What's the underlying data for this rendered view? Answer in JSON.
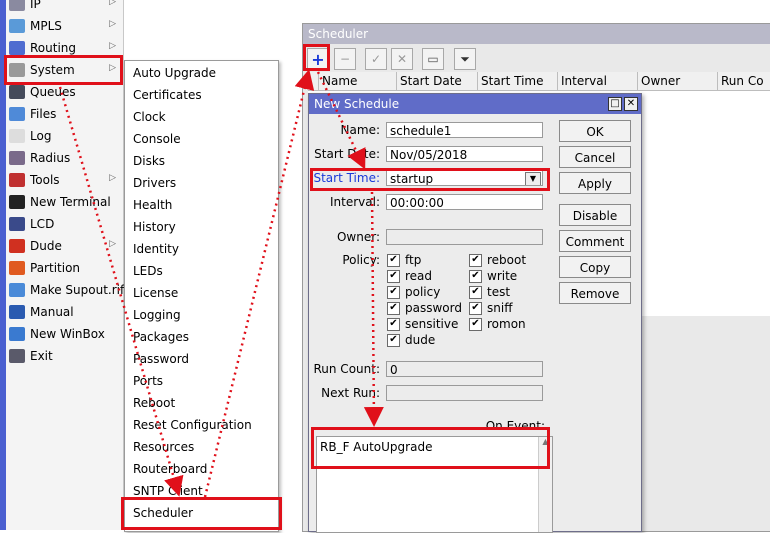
{
  "nav": {
    "items": [
      {
        "label": "IP",
        "icon": "ip-icon",
        "color": "#8a8aa0",
        "arrow": true
      },
      {
        "label": "MPLS",
        "icon": "mpls-icon",
        "color": "#5a9ad8",
        "arrow": true
      },
      {
        "label": "Routing",
        "icon": "routing-icon",
        "color": "#4f6cd0",
        "arrow": true
      },
      {
        "label": "System",
        "icon": "gear-icon",
        "color": "#9a9a9a",
        "arrow": true
      },
      {
        "label": "Queues",
        "icon": "queues-icon",
        "color": "#444a5a",
        "arrow": false
      },
      {
        "label": "Files",
        "icon": "folder-icon",
        "color": "#4f8ad8",
        "arrow": false
      },
      {
        "label": "Log",
        "icon": "log-icon",
        "color": "#dddddd",
        "arrow": false
      },
      {
        "label": "Radius",
        "icon": "radius-icon",
        "color": "#7a6a8a",
        "arrow": false
      },
      {
        "label": "Tools",
        "icon": "tools-icon",
        "color": "#c03030",
        "arrow": true
      },
      {
        "label": "New Terminal",
        "icon": "terminal-icon",
        "color": "#222222",
        "arrow": false
      },
      {
        "label": "LCD",
        "icon": "lcd-icon",
        "color": "#3a4a8a",
        "arrow": false
      },
      {
        "label": "Dude",
        "icon": "dude-icon",
        "color": "#d03020",
        "arrow": true
      },
      {
        "label": "Partition",
        "icon": "partition-icon",
        "color": "#e05a20",
        "arrow": false
      },
      {
        "label": "Make Supout.rif",
        "icon": "supout-icon",
        "color": "#4a8ad8",
        "arrow": false
      },
      {
        "label": "Manual",
        "icon": "manual-icon",
        "color": "#2a5ab0",
        "arrow": false
      },
      {
        "label": "New WinBox",
        "icon": "winbox-icon",
        "color": "#3a7ad0",
        "arrow": false
      },
      {
        "label": "Exit",
        "icon": "exit-icon",
        "color": "#5a5a6a",
        "arrow": false
      }
    ]
  },
  "submenu": {
    "items": [
      "Auto Upgrade",
      "Certificates",
      "Clock",
      "Console",
      "Disks",
      "Drivers",
      "Health",
      "History",
      "Identity",
      "LEDs",
      "License",
      "Logging",
      "Packages",
      "Password",
      "Ports",
      "Reboot",
      "Reset Configuration",
      "Resources",
      "Routerboard",
      "SNTP Client",
      "Scheduler"
    ]
  },
  "scheduler": {
    "title": "Scheduler",
    "toolbar": {
      "add": "+",
      "remove": "−",
      "enable": "✓",
      "disable": "✕",
      "comment": "▭",
      "filter": "⏷"
    },
    "columns": [
      "Name",
      "Start Date",
      "Start Time",
      "Interval",
      "Owner",
      "Run Co"
    ]
  },
  "dialog": {
    "title": "New Schedule",
    "restore_glyph": "□",
    "close_glyph": "✕",
    "fields": {
      "name_label": "Name:",
      "name_value": "schedule1",
      "start_date_label": "Start Date:",
      "start_date_value": "Nov/05/2018",
      "start_time_label": "Start Time:",
      "start_time_value": "startup",
      "interval_label": "Interval:",
      "interval_value": "00:00:00",
      "owner_label": "Owner:",
      "owner_value": "",
      "policy_label": "Policy:",
      "run_count_label": "Run Count:",
      "run_count_value": "0",
      "next_run_label": "Next Run:",
      "next_run_value": "",
      "on_event_label": "On Event:",
      "on_event_value": "RB_F AutoUpgrade"
    },
    "policies": [
      {
        "label": "ftp",
        "checked": true
      },
      {
        "label": "reboot",
        "checked": true
      },
      {
        "label": "read",
        "checked": true
      },
      {
        "label": "write",
        "checked": true
      },
      {
        "label": "policy",
        "checked": true
      },
      {
        "label": "test",
        "checked": true
      },
      {
        "label": "password",
        "checked": true
      },
      {
        "label": "sniff",
        "checked": true
      },
      {
        "label": "sensitive",
        "checked": true
      },
      {
        "label": "romon",
        "checked": true
      },
      {
        "label": "dude",
        "checked": true
      }
    ],
    "buttons": {
      "ok": "OK",
      "cancel": "Cancel",
      "apply": "Apply",
      "disable": "Disable",
      "comment": "Comment",
      "copy": "Copy",
      "remove": "Remove"
    }
  },
  "colors": {
    "highlight": "#e0101a",
    "start_time_label": "#1a3ad8",
    "dialog_title": "#606cc8"
  }
}
